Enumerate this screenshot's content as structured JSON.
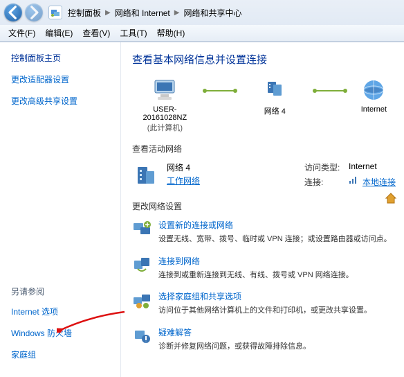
{
  "breadcrumb": {
    "item1": "控制面板",
    "item2": "网络和 Internet",
    "item3": "网络和共享中心"
  },
  "menu": {
    "file": "文件(F)",
    "edit": "编辑(E)",
    "view": "查看(V)",
    "tools": "工具(T)",
    "help": "帮助(H)"
  },
  "side": {
    "home": "控制面板主页",
    "adapter": "更改适配器设置",
    "sharing": "更改高级共享设置",
    "seealso_h": "另请参阅",
    "inet": "Internet 选项",
    "firewall": "Windows 防火墙",
    "homegroup": "家庭组"
  },
  "main": {
    "h1": "查看基本网络信息并设置连接",
    "node_pc": "USER-20161028NZ",
    "node_pc_sub": "(此计算机)",
    "node_net": "网络 4",
    "node_inet": "Internet",
    "active_h": "查看活动网络",
    "net_name": "网络 4",
    "net_type": "工作网络",
    "access_lbl": "访问类型:",
    "access_val": "Internet",
    "conn_lbl": "连接:",
    "conn_val": "本地连接",
    "change_h": "更改网络设置",
    "t1_t": "设置新的连接或网络",
    "t1_d": "设置无线、宽带、拨号、临时或 VPN 连接；或设置路由器或访问点。",
    "t2_t": "连接到网络",
    "t2_d": "连接到或重新连接到无线、有线、拨号或 VPN 网络连接。",
    "t3_t": "选择家庭组和共享选项",
    "t3_d": "访问位于其他网络计算机上的文件和打印机，或更改共享设置。",
    "t4_t": "疑难解答",
    "t4_d": "诊断并修复网络问题，或获得故障排除信息。"
  }
}
